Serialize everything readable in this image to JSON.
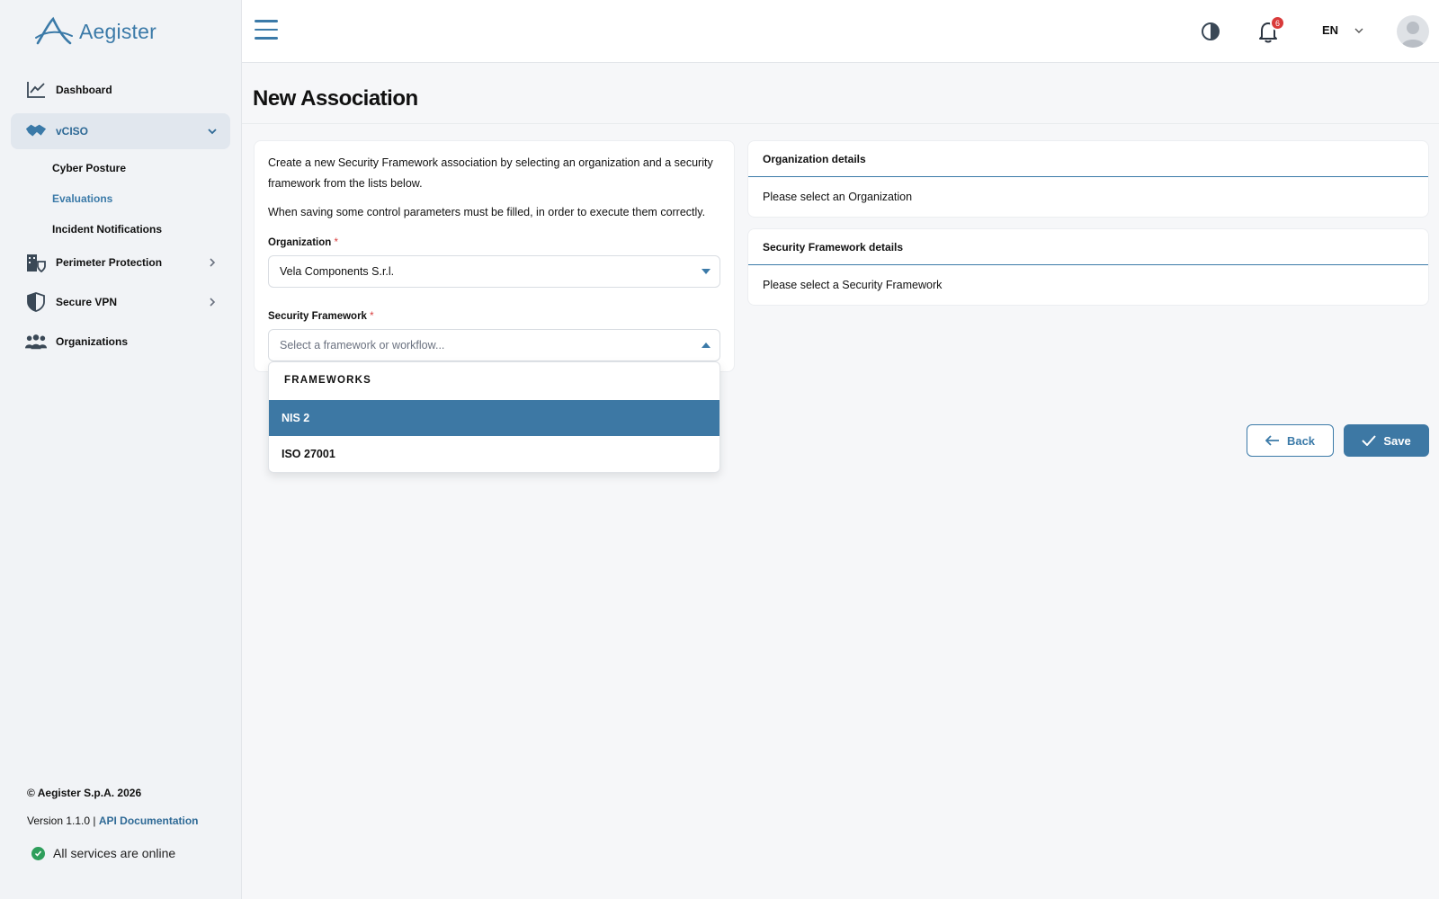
{
  "brand": {
    "name": "Aegister",
    "accent": "#3b7aa8"
  },
  "sidebar": {
    "items": [
      {
        "label": "Dashboard",
        "icon": "chart-line-icon"
      },
      {
        "label": "vCISO",
        "icon": "handshake-icon"
      },
      {
        "label": "Perimeter Protection",
        "icon": "building-shield-icon"
      },
      {
        "label": "Secure VPN",
        "icon": "shield-icon"
      },
      {
        "label": "Organizations",
        "icon": "users-icon"
      }
    ],
    "subitems": [
      {
        "label": "Cyber Posture"
      },
      {
        "label": "Evaluations"
      },
      {
        "label": "Incident Notifications"
      }
    ],
    "footer": {
      "copyright": "© Aegister S.p.A. 2026",
      "version": "Version 1.1.0 | ",
      "api_link": "API Documentation",
      "status": "All services are online"
    }
  },
  "header": {
    "notification_count": "6",
    "language": "EN"
  },
  "main": {
    "title": "New Association",
    "intro": "Create a new Security Framework association by selecting an organization and a security framework from the lists below.",
    "intro2": "When saving some control parameters must be filled, in order to execute them correctly.",
    "organization": {
      "label": "Organization",
      "required": "*",
      "value": "Vela Components S.r.l."
    },
    "framework": {
      "label": "Security Framework",
      "required": "*",
      "placeholder": "Select a framework or workflow...",
      "group_label": "FRAMEWORKS",
      "options": [
        {
          "label": "NIS 2"
        },
        {
          "label": "ISO 27001"
        }
      ],
      "selected_index": 0
    },
    "org_details": {
      "title": "Organization details",
      "body": "Please select an Organization"
    },
    "fw_details": {
      "title": "Security Framework details",
      "body": "Please select a Security Framework"
    },
    "buttons": {
      "back": "Back",
      "save": "Save"
    }
  }
}
